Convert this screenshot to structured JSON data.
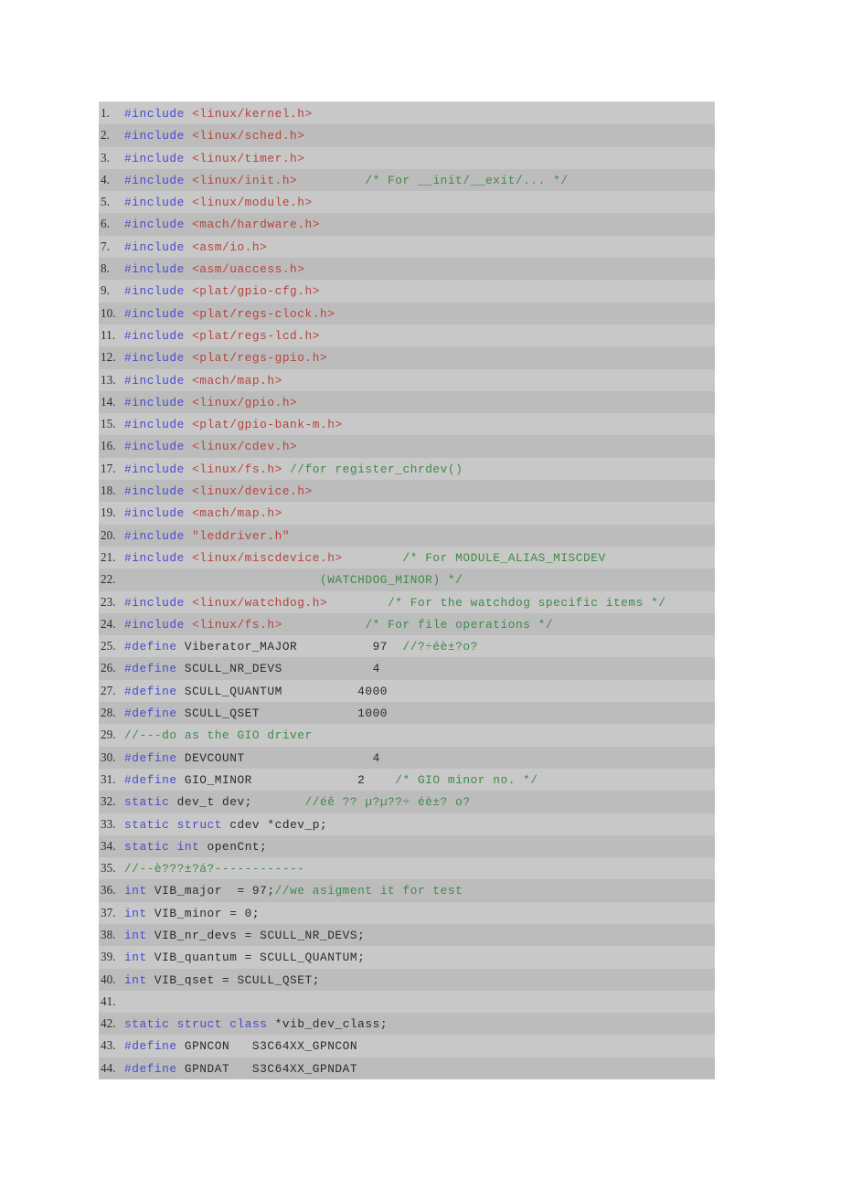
{
  "document": {
    "type": "source-code-listing",
    "language": "c",
    "theme": {
      "page_background": "#ffffff",
      "row_odd_background": "#c8c8c8",
      "row_even_background": "#bcbcbc",
      "preprocessor_color": "#4a4ad0",
      "keyword_color": "#4a4ad0",
      "header_color": "#b8433a",
      "string_color": "#b8433a",
      "comment_color": "#3f8a46",
      "plain_color": "#2b2b2b"
    },
    "total_lines": 44
  },
  "lines": [
    {
      "n": "1.",
      "tokens": [
        {
          "t": "pre",
          "v": "#include"
        },
        {
          "t": "txt",
          "v": " "
        },
        {
          "t": "hdr",
          "v": "<linux/kernel.h>"
        }
      ]
    },
    {
      "n": "2.",
      "tokens": [
        {
          "t": "pre",
          "v": "#include"
        },
        {
          "t": "txt",
          "v": " "
        },
        {
          "t": "hdr",
          "v": "<linux/sched.h>"
        }
      ]
    },
    {
      "n": "3.",
      "tokens": [
        {
          "t": "pre",
          "v": "#include"
        },
        {
          "t": "txt",
          "v": " "
        },
        {
          "t": "hdr",
          "v": "<linux/timer.h>"
        }
      ]
    },
    {
      "n": "4.",
      "tokens": [
        {
          "t": "pre",
          "v": "#include"
        },
        {
          "t": "txt",
          "v": " "
        },
        {
          "t": "hdr",
          "v": "<linux/init.h>"
        },
        {
          "t": "txt",
          "v": "         "
        },
        {
          "t": "cmt",
          "v": "/* For __init/__exit/... */"
        }
      ]
    },
    {
      "n": "5.",
      "tokens": [
        {
          "t": "pre",
          "v": "#include"
        },
        {
          "t": "txt",
          "v": " "
        },
        {
          "t": "hdr",
          "v": "<linux/module.h>"
        }
      ]
    },
    {
      "n": "6.",
      "tokens": [
        {
          "t": "pre",
          "v": "#include"
        },
        {
          "t": "txt",
          "v": " "
        },
        {
          "t": "hdr",
          "v": "<mach/hardware.h>"
        }
      ]
    },
    {
      "n": "7.",
      "tokens": [
        {
          "t": "pre",
          "v": "#include"
        },
        {
          "t": "txt",
          "v": " "
        },
        {
          "t": "hdr",
          "v": "<asm/io.h>"
        }
      ]
    },
    {
      "n": "8.",
      "tokens": [
        {
          "t": "pre",
          "v": "#include"
        },
        {
          "t": "txt",
          "v": " "
        },
        {
          "t": "hdr",
          "v": "<asm/uaccess.h>"
        }
      ]
    },
    {
      "n": "9.",
      "tokens": [
        {
          "t": "pre",
          "v": "#include"
        },
        {
          "t": "txt",
          "v": " "
        },
        {
          "t": "hdr",
          "v": "<plat/gpio-cfg.h>"
        }
      ]
    },
    {
      "n": "10.",
      "tokens": [
        {
          "t": "pre",
          "v": "#include"
        },
        {
          "t": "txt",
          "v": " "
        },
        {
          "t": "hdr",
          "v": "<plat/regs-clock.h>"
        }
      ]
    },
    {
      "n": "11.",
      "tokens": [
        {
          "t": "pre",
          "v": "#include"
        },
        {
          "t": "txt",
          "v": " "
        },
        {
          "t": "hdr",
          "v": "<plat/regs-lcd.h>"
        }
      ]
    },
    {
      "n": "12.",
      "tokens": [
        {
          "t": "pre",
          "v": "#include"
        },
        {
          "t": "txt",
          "v": " "
        },
        {
          "t": "hdr",
          "v": "<plat/regs-gpio.h>"
        }
      ]
    },
    {
      "n": "13.",
      "tokens": [
        {
          "t": "pre",
          "v": "#include"
        },
        {
          "t": "txt",
          "v": " "
        },
        {
          "t": "hdr",
          "v": "<mach/map.h>"
        }
      ]
    },
    {
      "n": "14.",
      "tokens": [
        {
          "t": "pre",
          "v": "#include"
        },
        {
          "t": "txt",
          "v": " "
        },
        {
          "t": "hdr",
          "v": "<linux/gpio.h>"
        }
      ]
    },
    {
      "n": "15.",
      "tokens": [
        {
          "t": "pre",
          "v": "#include"
        },
        {
          "t": "txt",
          "v": " "
        },
        {
          "t": "hdr",
          "v": "<plat/gpio-bank-m.h>"
        }
      ]
    },
    {
      "n": "16.",
      "tokens": [
        {
          "t": "pre",
          "v": "#include"
        },
        {
          "t": "txt",
          "v": " "
        },
        {
          "t": "hdr",
          "v": "<linux/cdev.h>"
        }
      ]
    },
    {
      "n": "17.",
      "tokens": [
        {
          "t": "pre",
          "v": "#include"
        },
        {
          "t": "txt",
          "v": " "
        },
        {
          "t": "hdr",
          "v": "<linux/fs.h>"
        },
        {
          "t": "txt",
          "v": " "
        },
        {
          "t": "cmt",
          "v": "//for register_chrdev()"
        }
      ]
    },
    {
      "n": "18.",
      "tokens": [
        {
          "t": "pre",
          "v": "#include"
        },
        {
          "t": "txt",
          "v": " "
        },
        {
          "t": "hdr",
          "v": "<linux/device.h>"
        }
      ]
    },
    {
      "n": "19.",
      "tokens": [
        {
          "t": "pre",
          "v": "#include"
        },
        {
          "t": "txt",
          "v": " "
        },
        {
          "t": "hdr",
          "v": "<mach/map.h>"
        }
      ]
    },
    {
      "n": "20.",
      "tokens": [
        {
          "t": "pre",
          "v": "#include"
        },
        {
          "t": "txt",
          "v": " "
        },
        {
          "t": "str",
          "v": "\"leddriver.h\""
        }
      ]
    },
    {
      "n": "21.",
      "tokens": [
        {
          "t": "pre",
          "v": "#include"
        },
        {
          "t": "txt",
          "v": " "
        },
        {
          "t": "hdr",
          "v": "<linux/miscdevice.h>"
        },
        {
          "t": "txt",
          "v": "        "
        },
        {
          "t": "cmt",
          "v": "/* For MODULE_ALIAS_MISCDEV"
        }
      ]
    },
    {
      "n": "22.",
      "tokens": [
        {
          "t": "txt",
          "v": "                          "
        },
        {
          "t": "cmt",
          "v": "(WATCHDOG_MINOR) */"
        }
      ]
    },
    {
      "n": "23.",
      "tokens": [
        {
          "t": "pre",
          "v": "#include"
        },
        {
          "t": "txt",
          "v": " "
        },
        {
          "t": "hdr",
          "v": "<linux/watchdog.h>"
        },
        {
          "t": "txt",
          "v": "        "
        },
        {
          "t": "cmt",
          "v": "/* For the watchdog specific items */"
        }
      ]
    },
    {
      "n": "24.",
      "tokens": [
        {
          "t": "pre",
          "v": "#include"
        },
        {
          "t": "txt",
          "v": " "
        },
        {
          "t": "hdr",
          "v": "<linux/fs.h>"
        },
        {
          "t": "txt",
          "v": "           "
        },
        {
          "t": "cmt",
          "v": "/* For file operations */"
        }
      ]
    },
    {
      "n": "25.",
      "tokens": [
        {
          "t": "pre",
          "v": "#define"
        },
        {
          "t": "txt",
          "v": " Viberator_MAJOR          97  "
        },
        {
          "t": "cmt",
          "v": "//?÷éè±?o?"
        }
      ]
    },
    {
      "n": "26.",
      "tokens": [
        {
          "t": "pre",
          "v": "#define"
        },
        {
          "t": "txt",
          "v": " SCULL_NR_DEVS            4"
        }
      ]
    },
    {
      "n": "27.",
      "tokens": [
        {
          "t": "pre",
          "v": "#define"
        },
        {
          "t": "txt",
          "v": " SCULL_QUANTUM          4000"
        }
      ]
    },
    {
      "n": "28.",
      "tokens": [
        {
          "t": "pre",
          "v": "#define"
        },
        {
          "t": "txt",
          "v": " SCULL_QSET             1000"
        }
      ]
    },
    {
      "n": "29.",
      "tokens": [
        {
          "t": "cmt",
          "v": "//---do as the GIO driver"
        }
      ]
    },
    {
      "n": "30.",
      "tokens": [
        {
          "t": "pre",
          "v": "#define"
        },
        {
          "t": "txt",
          "v": " DEVCOUNT                 4"
        }
      ]
    },
    {
      "n": "31.",
      "tokens": [
        {
          "t": "pre",
          "v": "#define"
        },
        {
          "t": "txt",
          "v": " GIO_MINOR              2    "
        },
        {
          "t": "cmt",
          "v": "/* GIO minor no. */"
        }
      ]
    },
    {
      "n": "32.",
      "tokens": [
        {
          "t": "kw",
          "v": "static"
        },
        {
          "t": "txt",
          "v": " dev_t dev;       "
        },
        {
          "t": "cmt",
          "v": "//éê ?? µ?µ??÷ éè±? o?"
        }
      ]
    },
    {
      "n": "33.",
      "tokens": [
        {
          "t": "kw",
          "v": "static"
        },
        {
          "t": "txt",
          "v": " "
        },
        {
          "t": "kw",
          "v": "struct"
        },
        {
          "t": "txt",
          "v": " cdev *cdev_p;"
        }
      ]
    },
    {
      "n": "34.",
      "tokens": [
        {
          "t": "kw",
          "v": "static"
        },
        {
          "t": "txt",
          "v": " "
        },
        {
          "t": "kw",
          "v": "int"
        },
        {
          "t": "txt",
          "v": " openCnt;"
        }
      ]
    },
    {
      "n": "35.",
      "tokens": [
        {
          "t": "cmt",
          "v": "//--è???±?á?------------"
        }
      ]
    },
    {
      "n": "36.",
      "tokens": [
        {
          "t": "kw",
          "v": "int"
        },
        {
          "t": "txt",
          "v": " VIB_major  = 97;"
        },
        {
          "t": "cmt",
          "v": "//we asigment it for test"
        }
      ]
    },
    {
      "n": "37.",
      "tokens": [
        {
          "t": "kw",
          "v": "int"
        },
        {
          "t": "txt",
          "v": " VIB_minor = 0;"
        }
      ]
    },
    {
      "n": "38.",
      "tokens": [
        {
          "t": "kw",
          "v": "int"
        },
        {
          "t": "txt",
          "v": " VIB_nr_devs = SCULL_NR_DEVS;"
        }
      ]
    },
    {
      "n": "39.",
      "tokens": [
        {
          "t": "kw",
          "v": "int"
        },
        {
          "t": "txt",
          "v": " VIB_quantum = SCULL_QUANTUM;"
        }
      ]
    },
    {
      "n": "40.",
      "tokens": [
        {
          "t": "kw",
          "v": "int"
        },
        {
          "t": "txt",
          "v": " VIB_qset = SCULL_QSET;"
        }
      ]
    },
    {
      "n": "41.",
      "tokens": []
    },
    {
      "n": "42.",
      "tokens": [
        {
          "t": "kw",
          "v": "static"
        },
        {
          "t": "txt",
          "v": " "
        },
        {
          "t": "kw",
          "v": "struct"
        },
        {
          "t": "txt",
          "v": " "
        },
        {
          "t": "kw",
          "v": "class"
        },
        {
          "t": "txt",
          "v": " *vib_dev_class;"
        }
      ]
    },
    {
      "n": "43.",
      "tokens": [
        {
          "t": "pre",
          "v": "#define"
        },
        {
          "t": "txt",
          "v": " GPNCON   S3C64XX_GPNCON"
        }
      ]
    },
    {
      "n": "44.",
      "tokens": [
        {
          "t": "pre",
          "v": "#define"
        },
        {
          "t": "txt",
          "v": " GPNDAT   S3C64XX_GPNDAT"
        }
      ]
    }
  ]
}
